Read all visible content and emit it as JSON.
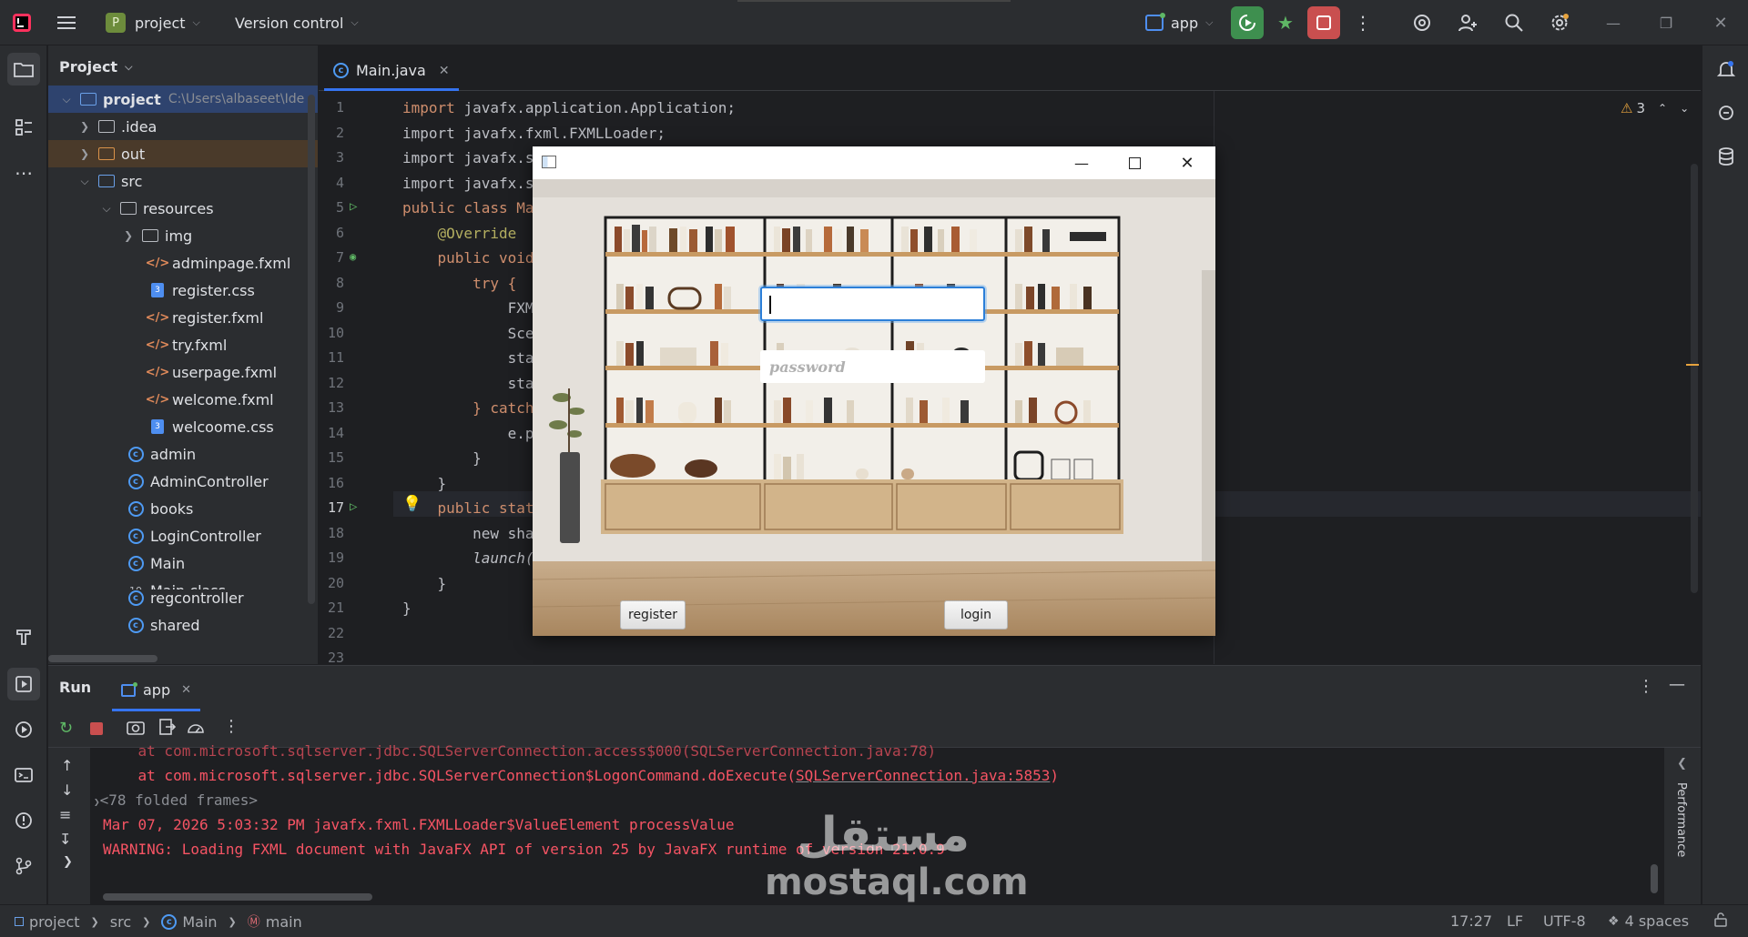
{
  "topbar": {
    "project_badge": "P",
    "project_name": "project",
    "version_control": "Version control",
    "run_config": "app"
  },
  "project_panel": {
    "title": "Project",
    "root_name": "project",
    "root_path": "C:\\Users\\albaseet\\Ide",
    "items": [
      {
        "label": ".idea"
      },
      {
        "label": "out"
      },
      {
        "label": "src"
      },
      {
        "label": "resources"
      },
      {
        "label": "img"
      },
      {
        "label": "adminpage.fxml"
      },
      {
        "label": "register.css"
      },
      {
        "label": "register.fxml"
      },
      {
        "label": "try.fxml"
      },
      {
        "label": "userpage.fxml"
      },
      {
        "label": "welcome.fxml"
      },
      {
        "label": "welcoome.css"
      },
      {
        "label": "admin"
      },
      {
        "label": "AdminController"
      },
      {
        "label": "books"
      },
      {
        "label": "LoginController"
      },
      {
        "label": "Main"
      },
      {
        "label": "Main.class"
      },
      {
        "label": "regcontroller"
      },
      {
        "label": "shared"
      }
    ]
  },
  "editor": {
    "tab_label": "Main.java",
    "warning_count": "3",
    "lines": [
      "1",
      "2",
      "3",
      "4",
      "5",
      "6",
      "7",
      "8",
      "9",
      "10",
      "11",
      "12",
      "13",
      "14",
      "15",
      "16",
      "17",
      "18",
      "19",
      "20",
      "21",
      "22",
      "23"
    ],
    "code": {
      "l1": "import javafx.application.Application;",
      "l2": "import javafx.fxml.FXMLLoader;",
      "l3": "import javafx.s",
      "l4": "import javafx.s",
      "l5": "public class Ma",
      "l6": "    @Override",
      "l7": "    public void",
      "l8": "        try {",
      "l9": "            FXM",
      "l9_tail": "\"));",
      "l10": "            Sce",
      "l11": "            sta",
      "l12": "            sta",
      "l13": "        } catch",
      "l14": "            e.p",
      "l15": "        }",
      "l16": "    }",
      "l17": "    public stat",
      "l18": "        new sha",
      "l19": "        launch(",
      "l20": "    }",
      "l21": "}"
    }
  },
  "run_panel": {
    "title": "Run",
    "tab_label": "app",
    "console": {
      "line0": "    at com.microsoft.sqlserver.jdbc.SQLServerConnection.access$000(SQLServerConnection.java:78)",
      "line1_prefix": "    at com.microsoft.sqlserver.jdbc.SQLServerConnection$LogonCommand.doExecute(",
      "line1_link": "SQLServerConnection.java:5853",
      "line1_suffix": ")",
      "line2": "<78 folded frames>",
      "line3": "Mar 07, 2026 5:03:32 PM javafx.fxml.FXMLLoader$ValueElement processValue",
      "line4": "WARNING: Loading FXML document with JavaFX API of version 25 by JavaFX runtime of version 21.0.9"
    },
    "side_tab": "Performance"
  },
  "app_window": {
    "password_placeholder": "password",
    "register_label": "register",
    "login_label": "login"
  },
  "statusbar": {
    "crumb_project": "project",
    "crumb_src": "src",
    "crumb_main": "Main",
    "crumb_method": "main",
    "position": "17:27",
    "line_sep": "LF",
    "encoding": "UTF-8",
    "indent": "4 spaces"
  },
  "watermark": {
    "arabic": "مستقل",
    "latin": "mostaql.com"
  },
  "colors": {
    "accent": "#3574f0",
    "error": "#f75464",
    "run_green": "#3e8f4f",
    "stop_red": "#c94f4f"
  }
}
